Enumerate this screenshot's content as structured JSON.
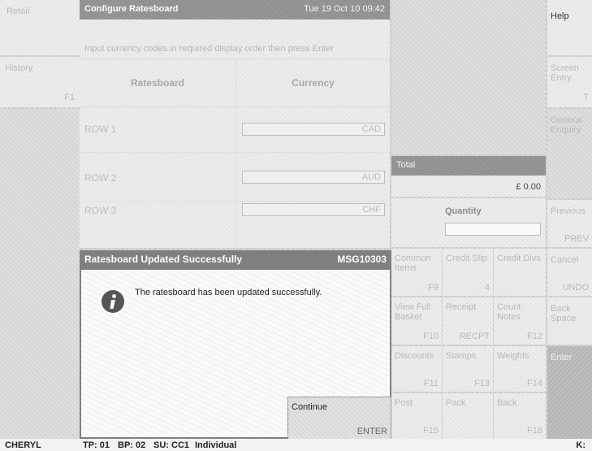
{
  "left": {
    "top_label": "Retail",
    "history_label": "History",
    "history_key": "F1"
  },
  "screen": {
    "title": "Configure Ratesboard",
    "datetime": "Tue 19 Oct 10  09:42",
    "instruction": "Input currency codes in required display order then press Enter",
    "headers": [
      "Ratesboard",
      "Currency"
    ],
    "rows": [
      {
        "label": "ROW 1",
        "value": "CAD"
      },
      {
        "label": "ROW 2",
        "value": "AUD"
      },
      {
        "label": "ROW 3",
        "value": "CHF"
      }
    ]
  },
  "total": {
    "label": "Total",
    "amount": "£ 0.00",
    "quantity_label": "Quantity",
    "quantity_value": ""
  },
  "keypad": [
    {
      "label": "Common Items",
      "key": "F9"
    },
    {
      "label": "Credit Slip",
      "key": "4"
    },
    {
      "label": "Credit Divs",
      "key": ""
    },
    {
      "label": "View Full Basket",
      "key": "F10"
    },
    {
      "label": "Receipt",
      "key": "RECPT"
    },
    {
      "label": "Count Notes",
      "key": "F12"
    },
    {
      "label": "Discounts",
      "key": "F11"
    },
    {
      "label": "Stamps",
      "key": "F13"
    },
    {
      "label": "Weights",
      "key": "F14"
    },
    {
      "label": "Post",
      "key": "F15"
    },
    {
      "label": "Pack",
      "key": ""
    },
    {
      "label": "Back",
      "key": "F16"
    }
  ],
  "right": {
    "help": "Help",
    "screen_entry": "Screen Entry",
    "screen_entry_key": "T",
    "general_enquiry": "General Enquiry",
    "previous": "Previous",
    "previous_key": "PREV",
    "cancel": "Cancel",
    "cancel_key": "UNDO",
    "back_space": "Back Space",
    "enter": "Enter"
  },
  "dialog": {
    "title": "Ratesboard Updated Successfully",
    "code": "MSG10303",
    "message": "The ratesboard has been updated successfully.",
    "icon": "info-icon",
    "continue_label": "Continue",
    "continue_key": "ENTER"
  },
  "status": {
    "user": "CHERYL",
    "tp": "TP: 01",
    "bp": "BP: 02",
    "su": "SU: CC1",
    "mode": "Individual",
    "right": "K:"
  }
}
